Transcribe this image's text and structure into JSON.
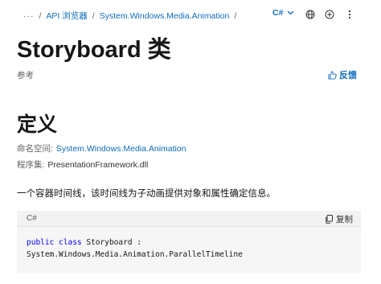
{
  "breadcrumb": {
    "more": "···",
    "items": [
      "API 浏览器",
      "System.Windows.Media.Animation"
    ],
    "separator": "/"
  },
  "toolbar": {
    "language": "C#",
    "icons": [
      "chevron-down-icon",
      "globe-icon",
      "add-circle-icon",
      "more-vertical-icon"
    ]
  },
  "page": {
    "title": "Storyboard 类",
    "reference_label": "参考",
    "feedback_label": "反馈"
  },
  "definition": {
    "heading": "定义",
    "namespace_label": "命名空间:",
    "namespace_value": "System.Windows.Media.Animation",
    "assembly_label": "程序集:",
    "assembly_value": "PresentationFramework.dll",
    "description": "一个容器时间线，该时间线为子动画提供对象和属性确定信息。"
  },
  "code_block": {
    "language": "C#",
    "copy_label": "复制",
    "line1_keywords": "public class",
    "line1_rest": " Storyboard :",
    "line2": "System.Windows.Media.Animation.ParallelTimeline"
  },
  "colors": {
    "link": "#0f6cbd",
    "keyword": "#0101fd",
    "text": "#161616",
    "muted": "#616161"
  }
}
